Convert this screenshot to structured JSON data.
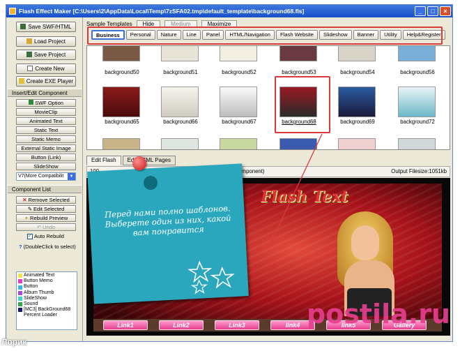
{
  "window": {
    "title": "Flash Effect Maker [C:\\Users\\2\\AppData\\Local\\Temp\\7zSFA02.tmp\\default_template\\background68.fls]"
  },
  "sidebar": {
    "buttons": [
      "Save SWF/HTML",
      "Load Project",
      "Save Project",
      "Create New",
      "Create EXE Player"
    ],
    "insert_header": "Insert/Edit Component",
    "components": [
      "SWF Option",
      "MovieClip",
      "Animated Text",
      "Static Text",
      "Static Memo",
      "External Static Image",
      "Button (Link)",
      "SlideShow"
    ],
    "version_select": "V7(More Compatibilit",
    "list_header": "Component List",
    "list_buttons": {
      "remove": "Remove Selected",
      "edit": "Edit Selected",
      "rebuild": "Rebuild Preview",
      "undo": "Undo"
    },
    "auto_rebuild": "Auto Rebuild",
    "hint": "(DoubleClick to select)",
    "component_list": [
      {
        "label": "Animated Text",
        "color": "#f2e24b"
      },
      {
        "label": "Button Memo",
        "color": "#e43ac8"
      },
      {
        "label": "Button",
        "color": "#37b3e6"
      },
      {
        "label": "Album Thumb",
        "color": "#a64ad8"
      },
      {
        "label": "SlideShow",
        "color": "#3fd6c8"
      },
      {
        "label": "Sound",
        "color": "#32a84a"
      },
      {
        "label": "[MC3] BackGround68",
        "color": "#1b1b6a"
      },
      {
        "label": "Percent Loader",
        "color": ""
      }
    ]
  },
  "sample": {
    "label": "Sample Templates",
    "hide": "Hide",
    "medium": "Medium",
    "maximize": "Maximize"
  },
  "categories": [
    "Business",
    "Personal",
    "Nature",
    "Line",
    "Panel",
    "HTML/Navigation",
    "Flash Website",
    "Slideshow",
    "Banner",
    "Utility",
    "Help&Register"
  ],
  "thumbnails_row1": [
    "background50",
    "background51",
    "background52",
    "background53",
    "background54",
    "background56"
  ],
  "thumbnails_row2": [
    "background65",
    "background66",
    "background67",
    "background68",
    "background69",
    "background72"
  ],
  "selected_thumb": "background68",
  "edit_tabs": [
    "Edit Flash",
    "Edit HTML Pages"
  ],
  "info": {
    "zoom": "100",
    "hint": "file to select component)",
    "filesize": "Output Filesize:1051kb"
  },
  "preview": {
    "flash_text": "Flash Text",
    "links": [
      "Link1",
      "Link2",
      "Link3",
      "link4",
      "link5",
      "Gallery"
    ]
  },
  "callout": {
    "message": "Перед нами полно шаблонов. Выберете один из них, какой вам понравится"
  },
  "watermark": {
    "main": "postila",
    "suffix": ".ru",
    "author": "Лорик"
  }
}
